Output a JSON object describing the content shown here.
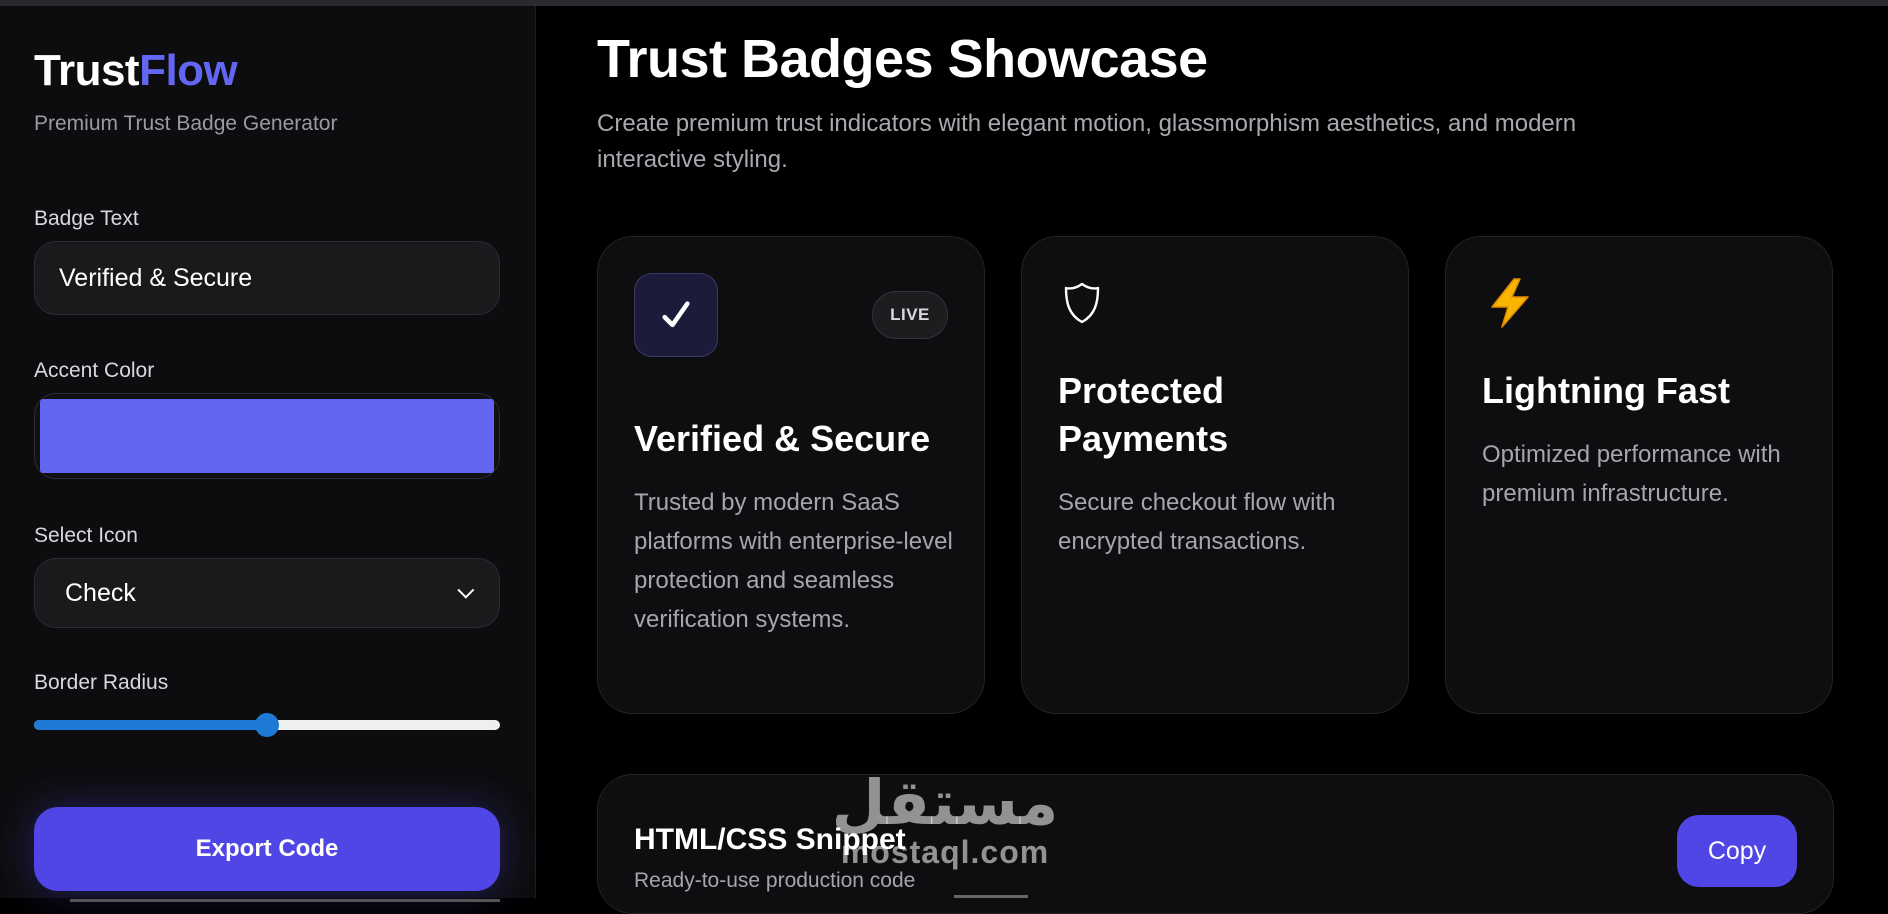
{
  "brand": {
    "name_part1": "Trust",
    "name_part2": "Flow",
    "tagline": "Premium Trust Badge Generator"
  },
  "controls": {
    "badge_text_label": "Badge Text",
    "badge_text_value": "Verified & Secure",
    "accent_color_label": "Accent Color",
    "accent_color_value": "#6366f1",
    "icon_label": "Select Icon",
    "icon_selected": "Check",
    "radius_label": "Border Radius",
    "radius_fraction": 0.5,
    "export_label": "Export Code"
  },
  "main": {
    "title": "Trust Badges Showcase",
    "subtitle": "Create premium trust indicators with elegant motion, glassmorphism aesthetics, and modern interactive styling."
  },
  "cards": [
    {
      "icon": "check-icon",
      "badge": "LIVE",
      "title": "Verified & Secure",
      "description": "Trusted by modern SaaS platforms with enterprise-level protection and seamless verification systems."
    },
    {
      "icon": "shield-icon",
      "title": "Protected Payments",
      "description": "Secure checkout flow with encrypted transactions."
    },
    {
      "icon": "lightning-icon",
      "title": "Lightning Fast",
      "description": "Optimized performance with premium infrastructure."
    }
  ],
  "snippet": {
    "title": "HTML/CSS Snippet",
    "subtitle": "Ready-to-use production code",
    "copy_label": "Copy"
  },
  "watermark": {
    "arabic": "مستقل",
    "latin": "mostaql.com"
  },
  "colors": {
    "accent": "#6366f1",
    "button": "#4f46e5",
    "slider": "#1e7ad6",
    "background": "#000000"
  }
}
